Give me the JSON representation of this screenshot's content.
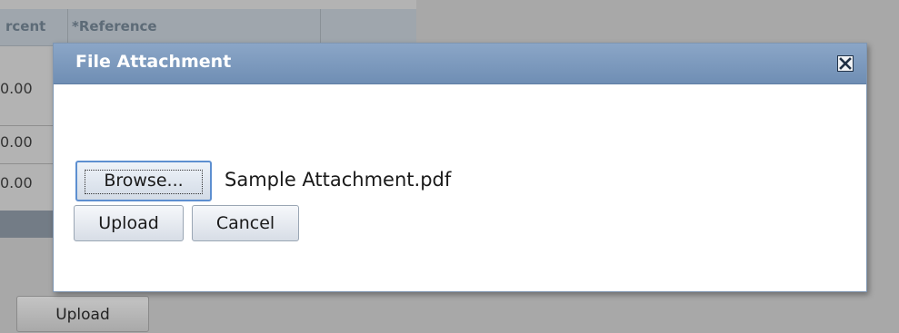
{
  "background": {
    "grid_header": {
      "col1": "rcent",
      "col2": "*Reference"
    },
    "rows": [
      "0.00",
      "0.00",
      "0.00"
    ],
    "upload_label": "Upload"
  },
  "dialog": {
    "title": "File Attachment",
    "close_icon": "close-icon",
    "browse_label": "Browse...",
    "selected_file": "Sample Attachment.pdf",
    "upload_label": "Upload",
    "cancel_label": "Cancel"
  },
  "colors": {
    "titlebar": "#7b98bd",
    "dialog_bg": "#ffffff",
    "overlay": "#a8a8a8"
  }
}
